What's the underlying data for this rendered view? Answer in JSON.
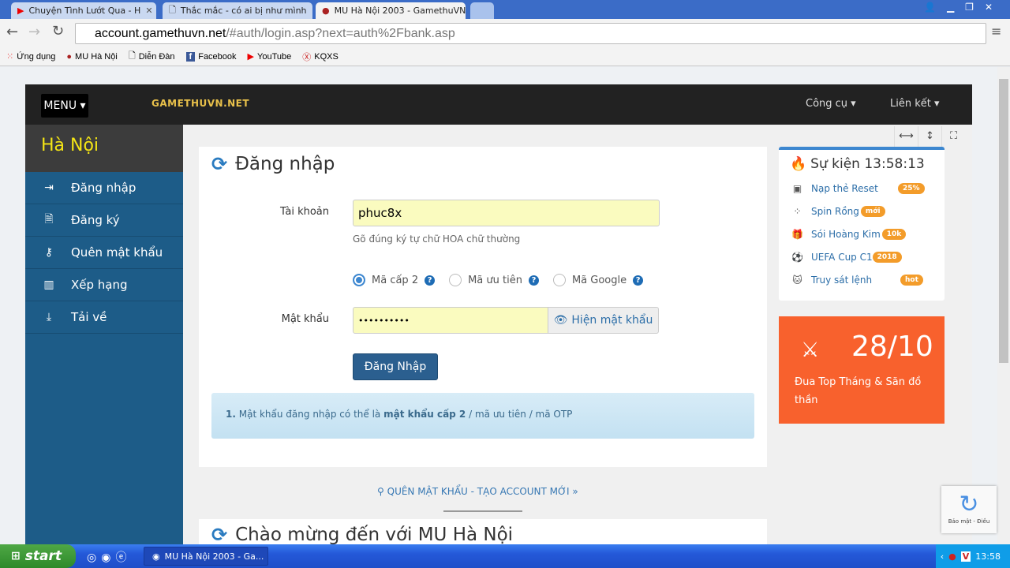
{
  "browser": {
    "tabs": [
      {
        "title": "Chuyện Tình Lướt Qua - H",
        "icon": "youtube-icon"
      },
      {
        "title": "Thắc mắc - có ai bị như mình",
        "icon": "document-icon"
      },
      {
        "title": "MU Hà Nội 2003 - GamethuVN",
        "icon": "mu-icon"
      }
    ],
    "url_host": "account.gamethuvn.net",
    "url_path": "/#auth/login.asp?next=auth%2Fbank.asp",
    "bookmarks": [
      "Ứng dụng",
      "MU Hà Nội",
      "Diễn Đàn",
      "Facebook",
      "YouTube",
      "KQXS"
    ]
  },
  "navbar": {
    "menu": "MENU",
    "logo": "GAMETHUVN.NET",
    "tools": "Công cụ",
    "links": "Liên kết"
  },
  "sidebar": {
    "title": "Hà Nội",
    "items": [
      {
        "label": "Đăng nhập",
        "icon": "sign-in-icon"
      },
      {
        "label": "Đăng ký",
        "icon": "file-icon"
      },
      {
        "label": "Quên mật khẩu",
        "icon": "key-icon"
      },
      {
        "label": "Xếp hạng",
        "icon": "bar-chart-icon"
      },
      {
        "label": "Tải về",
        "icon": "download-icon"
      }
    ]
  },
  "login": {
    "title": "Đăng nhập",
    "account_label": "Tài khoản",
    "account_value": "phuc8x",
    "account_hint": "Gõ đúng ký tự chữ HOA chữ thường",
    "radios": [
      {
        "label": "Mã cấp 2",
        "checked": true
      },
      {
        "label": "Mã ưu tiên",
        "checked": false
      },
      {
        "label": "Mã Google",
        "checked": false
      }
    ],
    "password_label": "Mật khẩu",
    "password_value": "••••••••••",
    "show_password": "Hiện mật khẩu",
    "submit": "Đăng Nhập",
    "note_num": "1.",
    "note_a": "Mật khẩu đăng nhập có thể là",
    "note_bold": "mật khẩu cấp 2",
    "note_b": "/ mã ưu tiên / mã OTP"
  },
  "links": "QUÊN MẬT KHẨU - TẠO ACCOUNT MỚI »",
  "welcome": "Chào mừng đến với MU Hà Nội",
  "events": {
    "title": "Sự kiện 13:58:13",
    "items": [
      {
        "label": "Nạp thẻ Reset",
        "badge": "25%",
        "icon": "money-icon"
      },
      {
        "label": "Spin Rồng",
        "badge": "mới",
        "icon": "spinner-icon"
      },
      {
        "label": "Sói Hoàng Kim",
        "badge": "10k",
        "icon": "gift-icon"
      },
      {
        "label": "UEFA Cup C1",
        "badge": "2018",
        "icon": "soccer-ball-icon"
      },
      {
        "label": "Truy sát lệnh",
        "badge": "hot",
        "icon": "github-cat-icon"
      }
    ]
  },
  "promo": {
    "date": "28/10",
    "text": "Đua Top Tháng & Săn đồ thần"
  },
  "recaptcha": "Bảo mật - Điều",
  "taskbar": {
    "start": "start",
    "task": "MU Hà Nội 2003 - Ga...",
    "clock": "13:58"
  },
  "colors": {
    "sidebar": "#1d5c88",
    "accent": "#3d87d0",
    "promo": "#f8612d",
    "badge": "#f39c2a"
  }
}
